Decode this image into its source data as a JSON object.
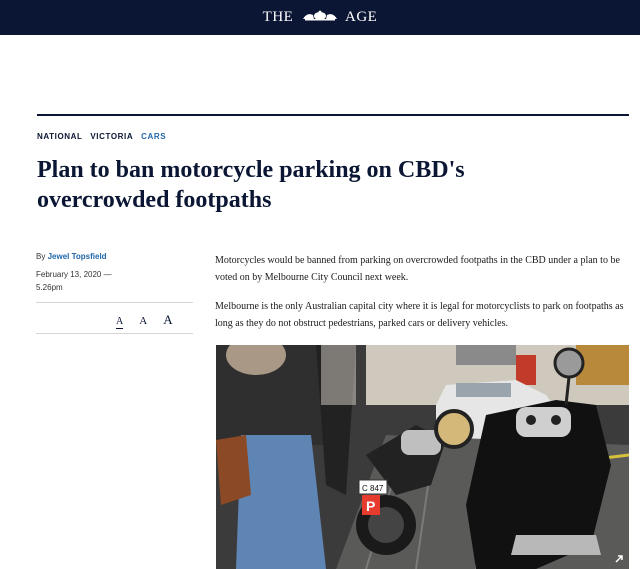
{
  "masthead": {
    "left": "THE",
    "right": "AGE"
  },
  "breadcrumb": [
    "NATIONAL",
    "VICTORIA",
    "CARS"
  ],
  "headline": "Plan to ban motorcycle parking on CBD's overcrowded footpaths",
  "byline": {
    "prefix": "By",
    "author": "Jewel Topsfield",
    "date": "February 13, 2020 — 5.26pm"
  },
  "font_size_controls": [
    "A",
    "A",
    "A"
  ],
  "body": [
    "Motorcycles would be banned from parking on overcrowded footpaths in the CBD under a plan to be voted on by Melbourne City Council next week.",
    "Melbourne is the only Australian capital city where it is legal for motorcyclists to park on footpaths as long as they do not obstruct pedestrians, parked cars or delivery vehicles."
  ],
  "photo": {
    "plate_text": "C 847",
    "p_sign": "P"
  },
  "colors": {
    "navy": "#0a1633",
    "link_blue": "#2166a8"
  },
  "icons": [
    "crest-icon",
    "expand-icon"
  ]
}
